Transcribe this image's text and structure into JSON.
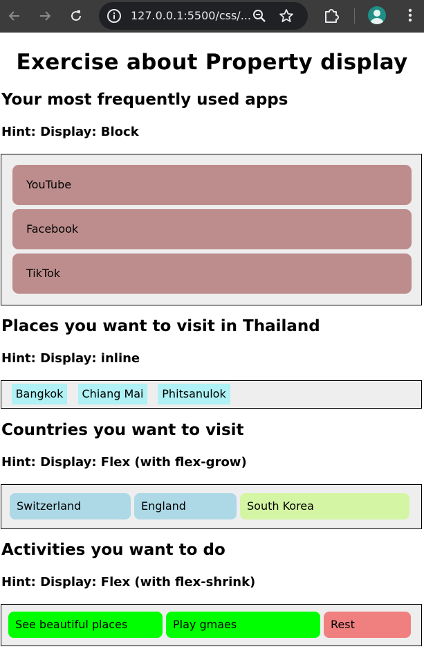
{
  "browser": {
    "url": "127.0.0.1:5500/css/...",
    "avatar_color": "#1f8f86"
  },
  "page": {
    "title": "Exercise about Property display"
  },
  "sections": [
    {
      "heading": "Your most frequently used apps",
      "hint": "Hint: Display: Block",
      "items": [
        "YouTube",
        "Facebook",
        "TikTok"
      ],
      "item_color": "#bc8d8c"
    },
    {
      "heading": "Places you want to visit in Thailand",
      "hint": "Hint: Display: inline",
      "items": [
        "Bangkok",
        "Chiang Mai",
        "Phitsanulok"
      ],
      "item_color": "#aff1f4"
    },
    {
      "heading": "Countries you want to visit",
      "hint": "Hint: Display: Flex (with flex-grow)",
      "items": [
        "Switzerland",
        "England",
        "South Korea"
      ],
      "item_colors": [
        "#add8e6",
        "#add8e6",
        "#d4f5a3"
      ]
    },
    {
      "heading": "Activities you want to do",
      "hint": "Hint: Display: Flex (with flex-shrink)",
      "items": [
        "See beautiful places",
        "Play gmaes",
        "Rest"
      ],
      "item_colors": [
        "#00ff00",
        "#00ff00",
        "#f08080"
      ]
    }
  ]
}
